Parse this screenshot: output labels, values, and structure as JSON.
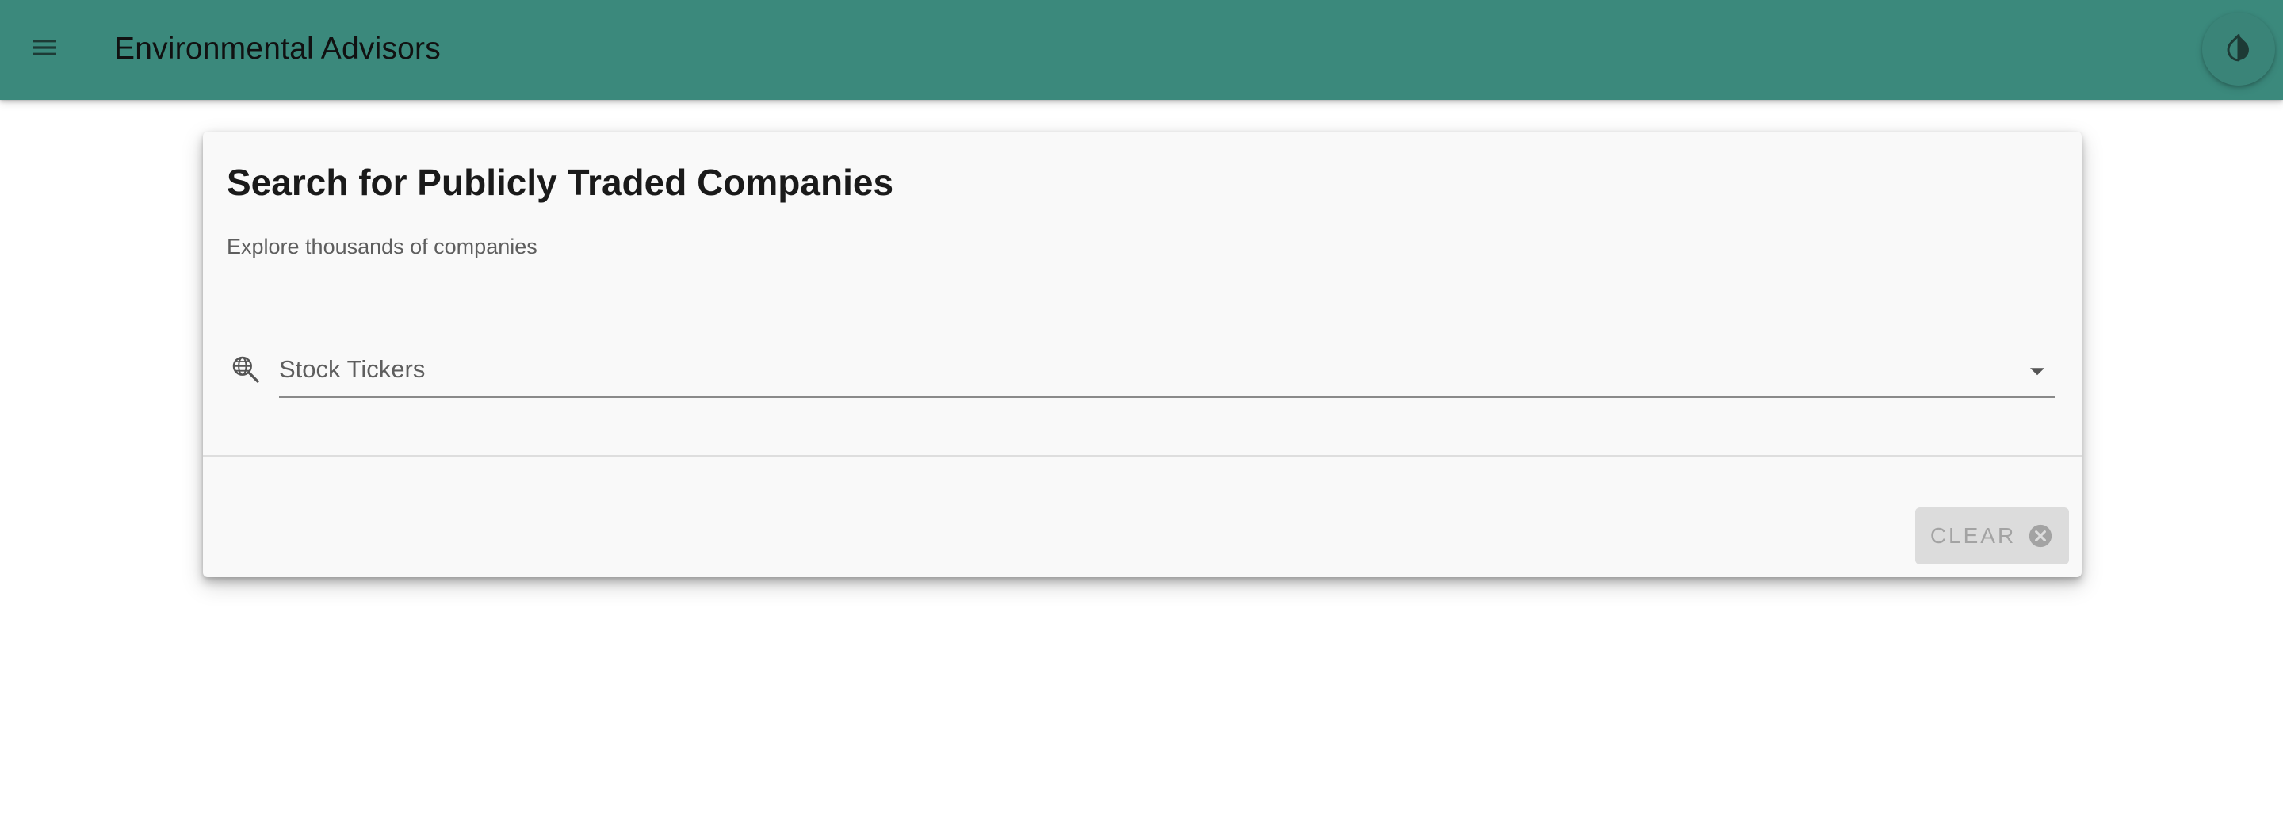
{
  "header": {
    "title": "Environmental Advisors",
    "menu_icon": "menu-icon",
    "theme_icon": "contrast-icon",
    "background_color": "#3b897c"
  },
  "card": {
    "title": "Search for Publicly Traded Companies",
    "subtitle": "Explore thousands of companies",
    "search": {
      "icon": "search-globe-icon",
      "placeholder": "Stock Tickers",
      "value": ""
    },
    "actions": {
      "clear_label": "CLEAR",
      "clear_icon": "cancel-circle-icon",
      "clear_disabled": true
    }
  }
}
